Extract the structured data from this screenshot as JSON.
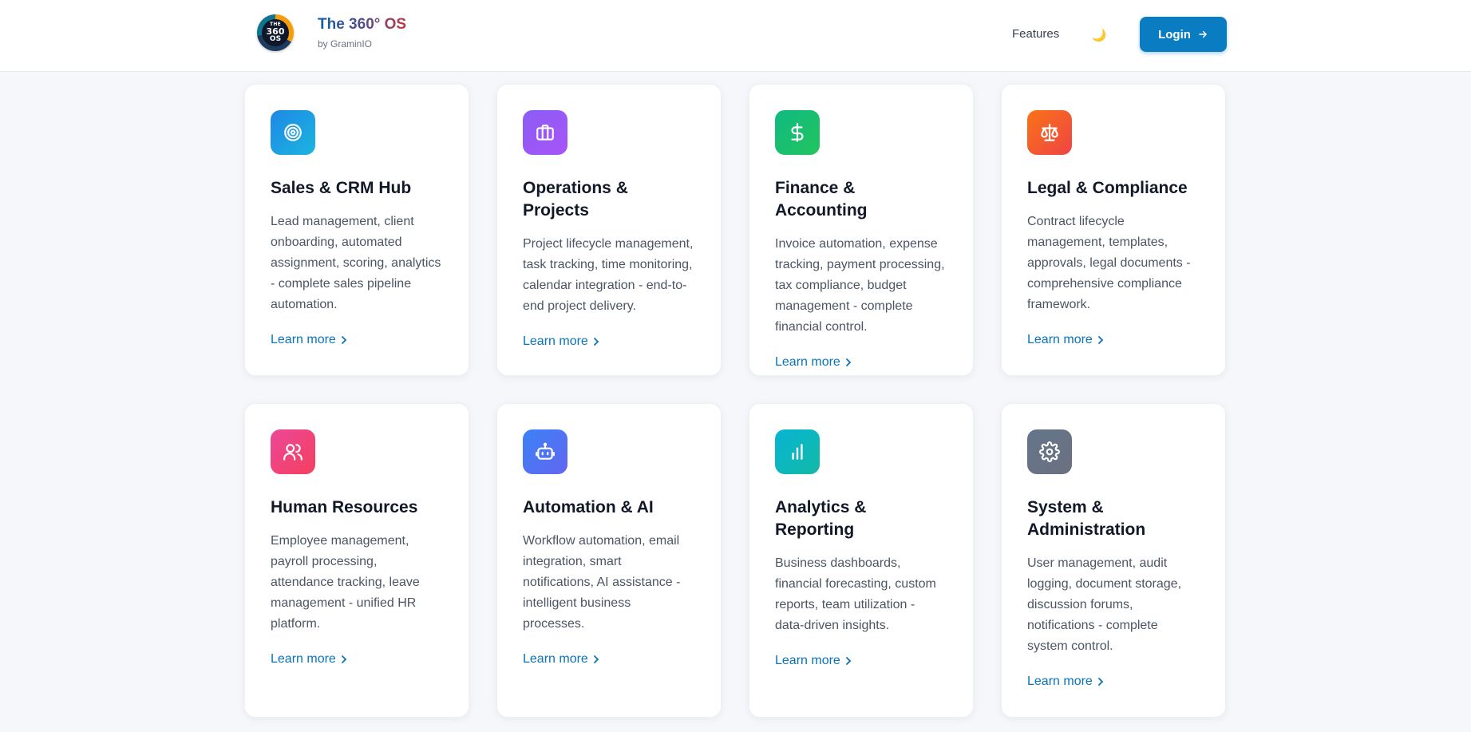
{
  "header": {
    "logo_text": [
      "THE",
      "360",
      "OS"
    ],
    "title": "The 360° OS",
    "subtitle": "by GraminIO",
    "nav_features": "Features",
    "theme_icon": "🌙",
    "login_label": "Login"
  },
  "colors": {
    "primary": "#0a7cc2",
    "link": "#0a73b9"
  },
  "cards": [
    {
      "title": "Sales & CRM Hub",
      "desc": "Lead management, client onboarding, automated assignment, scoring, analytics - complete sales pipeline automation.",
      "link": "Learn more",
      "icon": "target-icon",
      "color_from": "#1e88e5",
      "color_to": "#1cb5e0"
    },
    {
      "title": "Operations & Projects",
      "desc": "Project lifecycle management, task tracking, time monitoring, calendar integration - end-to-end project delivery.",
      "link": "Learn more",
      "icon": "briefcase-icon",
      "color_from": "#8b5cf6",
      "color_to": "#a855f7"
    },
    {
      "title": "Finance & Accounting",
      "desc": "Invoice automation, expense tracking, payment processing, tax compliance, budget management - complete financial control.",
      "link": "Learn more",
      "icon": "dollar-icon",
      "color_from": "#10b981",
      "color_to": "#22c55e"
    },
    {
      "title": "Legal & Compliance",
      "desc": "Contract lifecycle management, templates, approvals, legal documents - comprehensive compliance framework.",
      "link": "Learn more",
      "icon": "scale-icon",
      "color_from": "#f97316",
      "color_to": "#ef4444"
    },
    {
      "title": "Human Resources",
      "desc": "Employee management, payroll processing, attendance tracking, leave management - unified HR platform.",
      "link": "Learn more",
      "icon": "users-icon",
      "color_from": "#ec4899",
      "color_to": "#f43f5e"
    },
    {
      "title": "Automation & AI",
      "desc": "Workflow automation, email integration, smart notifications, AI assistance - intelligent business processes.",
      "link": "Learn more",
      "icon": "robot-icon",
      "color_from": "#3b82f6",
      "color_to": "#6366f1"
    },
    {
      "title": "Analytics & Reporting",
      "desc": "Business dashboards, financial forecasting, custom reports, team utilization - data-driven insights.",
      "link": "Learn more",
      "icon": "bar-chart-icon",
      "color_from": "#06b6d4",
      "color_to": "#14b8a6"
    },
    {
      "title": "System & Administration",
      "desc": "User management, audit logging, document storage, discussion forums, notifications - complete system control.",
      "link": "Learn more",
      "icon": "gear-icon",
      "color_from": "#64748b",
      "color_to": "#6b7280"
    }
  ]
}
